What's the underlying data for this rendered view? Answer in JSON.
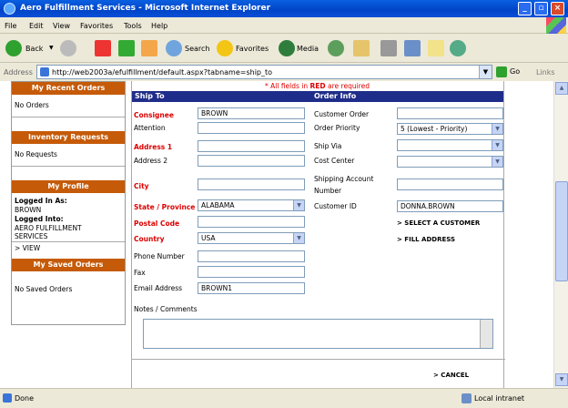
{
  "window": {
    "title": "Aero Fulfillment Services - Microsoft Internet Explorer"
  },
  "menu": [
    "File",
    "Edit",
    "View",
    "Favorites",
    "Tools",
    "Help"
  ],
  "toolbar": {
    "back": "Back",
    "search": "Search",
    "favorites": "Favorites",
    "media": "Media"
  },
  "address": {
    "label": "Address",
    "url": "http://web2003a/efulfillment/default.aspx?tabname=ship_to",
    "go": "Go",
    "links": "Links"
  },
  "sidebar": {
    "recent_orders": {
      "title": "My Recent Orders",
      "text": "No Orders"
    },
    "inventory": {
      "title": "Inventory Requests",
      "text": "No Requests"
    },
    "profile": {
      "title": "My Profile",
      "logged_in_as_label": "Logged In As:",
      "user": "BROWN",
      "logged_into_label": "Logged Into:",
      "company_1": "AERO FULFILLMENT",
      "company_2": "SERVICES",
      "view": "> VIEW"
    },
    "saved_orders": {
      "title": "My Saved Orders",
      "text": "No Saved Orders"
    }
  },
  "required_note": {
    "pre": "* All fields in ",
    "red": "RED",
    "post": " are required"
  },
  "ship_to": {
    "header": "Ship To",
    "consignee": {
      "label": "Consignee",
      "value": "BROWN"
    },
    "attention": {
      "label": "Attention",
      "value": ""
    },
    "address1": {
      "label": "Address 1",
      "value": ""
    },
    "address2": {
      "label": "Address 2",
      "value": ""
    },
    "city": {
      "label": "City",
      "value": ""
    },
    "state": {
      "label": "State / Province",
      "value": "ALABAMA"
    },
    "postal": {
      "label": "Postal Code",
      "value": ""
    },
    "country": {
      "label": "Country",
      "value": "USA"
    },
    "phone": {
      "label": "Phone Number",
      "value": ""
    },
    "fax": {
      "label": "Fax",
      "value": ""
    },
    "email": {
      "label": "Email Address",
      "value": "BROWN1"
    }
  },
  "order_info": {
    "header": "Order Info",
    "customer_order": {
      "label": "Customer Order",
      "value": ""
    },
    "priority": {
      "label": "Order Priority",
      "value": "5 (Lowest - Priority)"
    },
    "ship_via": {
      "label": "Ship Via",
      "value": ""
    },
    "cost_center": {
      "label": "Cost Center",
      "value": ""
    },
    "shipping_account_1": "Shipping Account",
    "shipping_account_2": "Number",
    "customer_id": {
      "label": "Customer ID",
      "value": "DONNA.BROWN"
    },
    "select_customer": "> SELECT A CUSTOMER",
    "fill_address": "> FILL ADDRESS"
  },
  "notes": {
    "label": "Notes / Comments"
  },
  "cancel": "> CANCEL",
  "status": {
    "done": "Done",
    "zone": "Local intranet"
  },
  "colors": {
    "sidebar_header": "#c55a08",
    "section_header": "#1f2d8a",
    "required": "#dd0000"
  }
}
